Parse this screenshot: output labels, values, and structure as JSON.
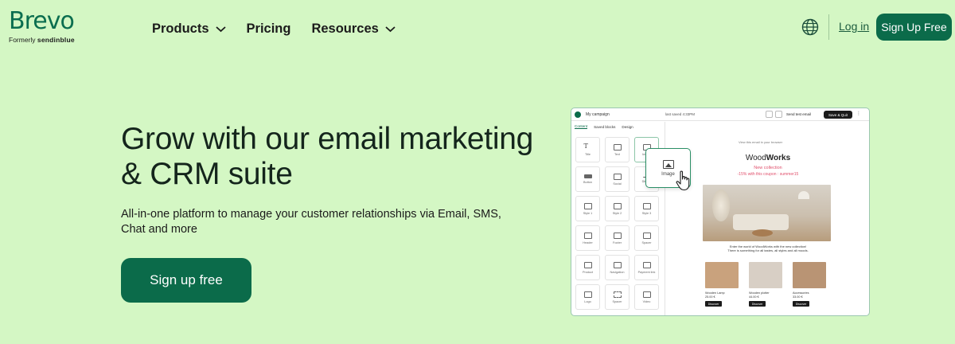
{
  "header": {
    "logo": "Brevo",
    "logo_formerly": "Formerly",
    "logo_sub": "sendinblue",
    "nav": [
      {
        "label": "Products",
        "has_dropdown": true
      },
      {
        "label": "Pricing",
        "has_dropdown": false
      },
      {
        "label": "Resources",
        "has_dropdown": true
      }
    ],
    "language_icon": "globe-icon",
    "login": "Log in",
    "signup": "Sign Up Free"
  },
  "hero": {
    "title": "Grow with our email marketing & CRM suite",
    "subtitle": "All-in-one platform to manage your customer relationships via Email, SMS, Chat and more",
    "cta": "Sign up free"
  },
  "editor": {
    "campaign": "My campaign",
    "saved": "last saved 4:33PM",
    "send_test": "Send test email",
    "save_quit": "Save & Quit",
    "tabs": [
      "Content",
      "Saved blocks",
      "Design"
    ],
    "blocks": [
      "Title",
      "Text",
      "Image",
      "Button",
      "Social",
      "Divider",
      "Style 1",
      "Style 2",
      "Style 3",
      "Header",
      "Footer",
      "Spacer",
      "Product",
      "Navigation",
      "Payment link",
      "Logo",
      "Spacer",
      "Video"
    ],
    "drag_label": "Image",
    "email": {
      "view_in_browser": "View this email in your browser",
      "brand_prefix": "Wood",
      "brand_suffix": "Works",
      "new_collection": "New collection",
      "coupon": "-15% with this coupon : summer15",
      "body_line1": "Enter the world of WoodWorks with the new collection!",
      "body_line2": "There is something for all tastes, all styles and all moods.",
      "products": [
        {
          "name": "Wooden Lamp",
          "price": "25.00 €",
          "button": "Discover",
          "color": "#c9a27d"
        },
        {
          "name": "Wooden plotter",
          "price": "44.00 €",
          "button": "Discover",
          "color": "#d8cfc5"
        },
        {
          "name": "Accessories",
          "price": "33.00 €",
          "button": "Discover",
          "color": "#b99474"
        }
      ]
    }
  },
  "colors": {
    "background": "#d4f7c4",
    "brand_green": "#0b6b4a",
    "accent_pink": "#e0506c"
  }
}
